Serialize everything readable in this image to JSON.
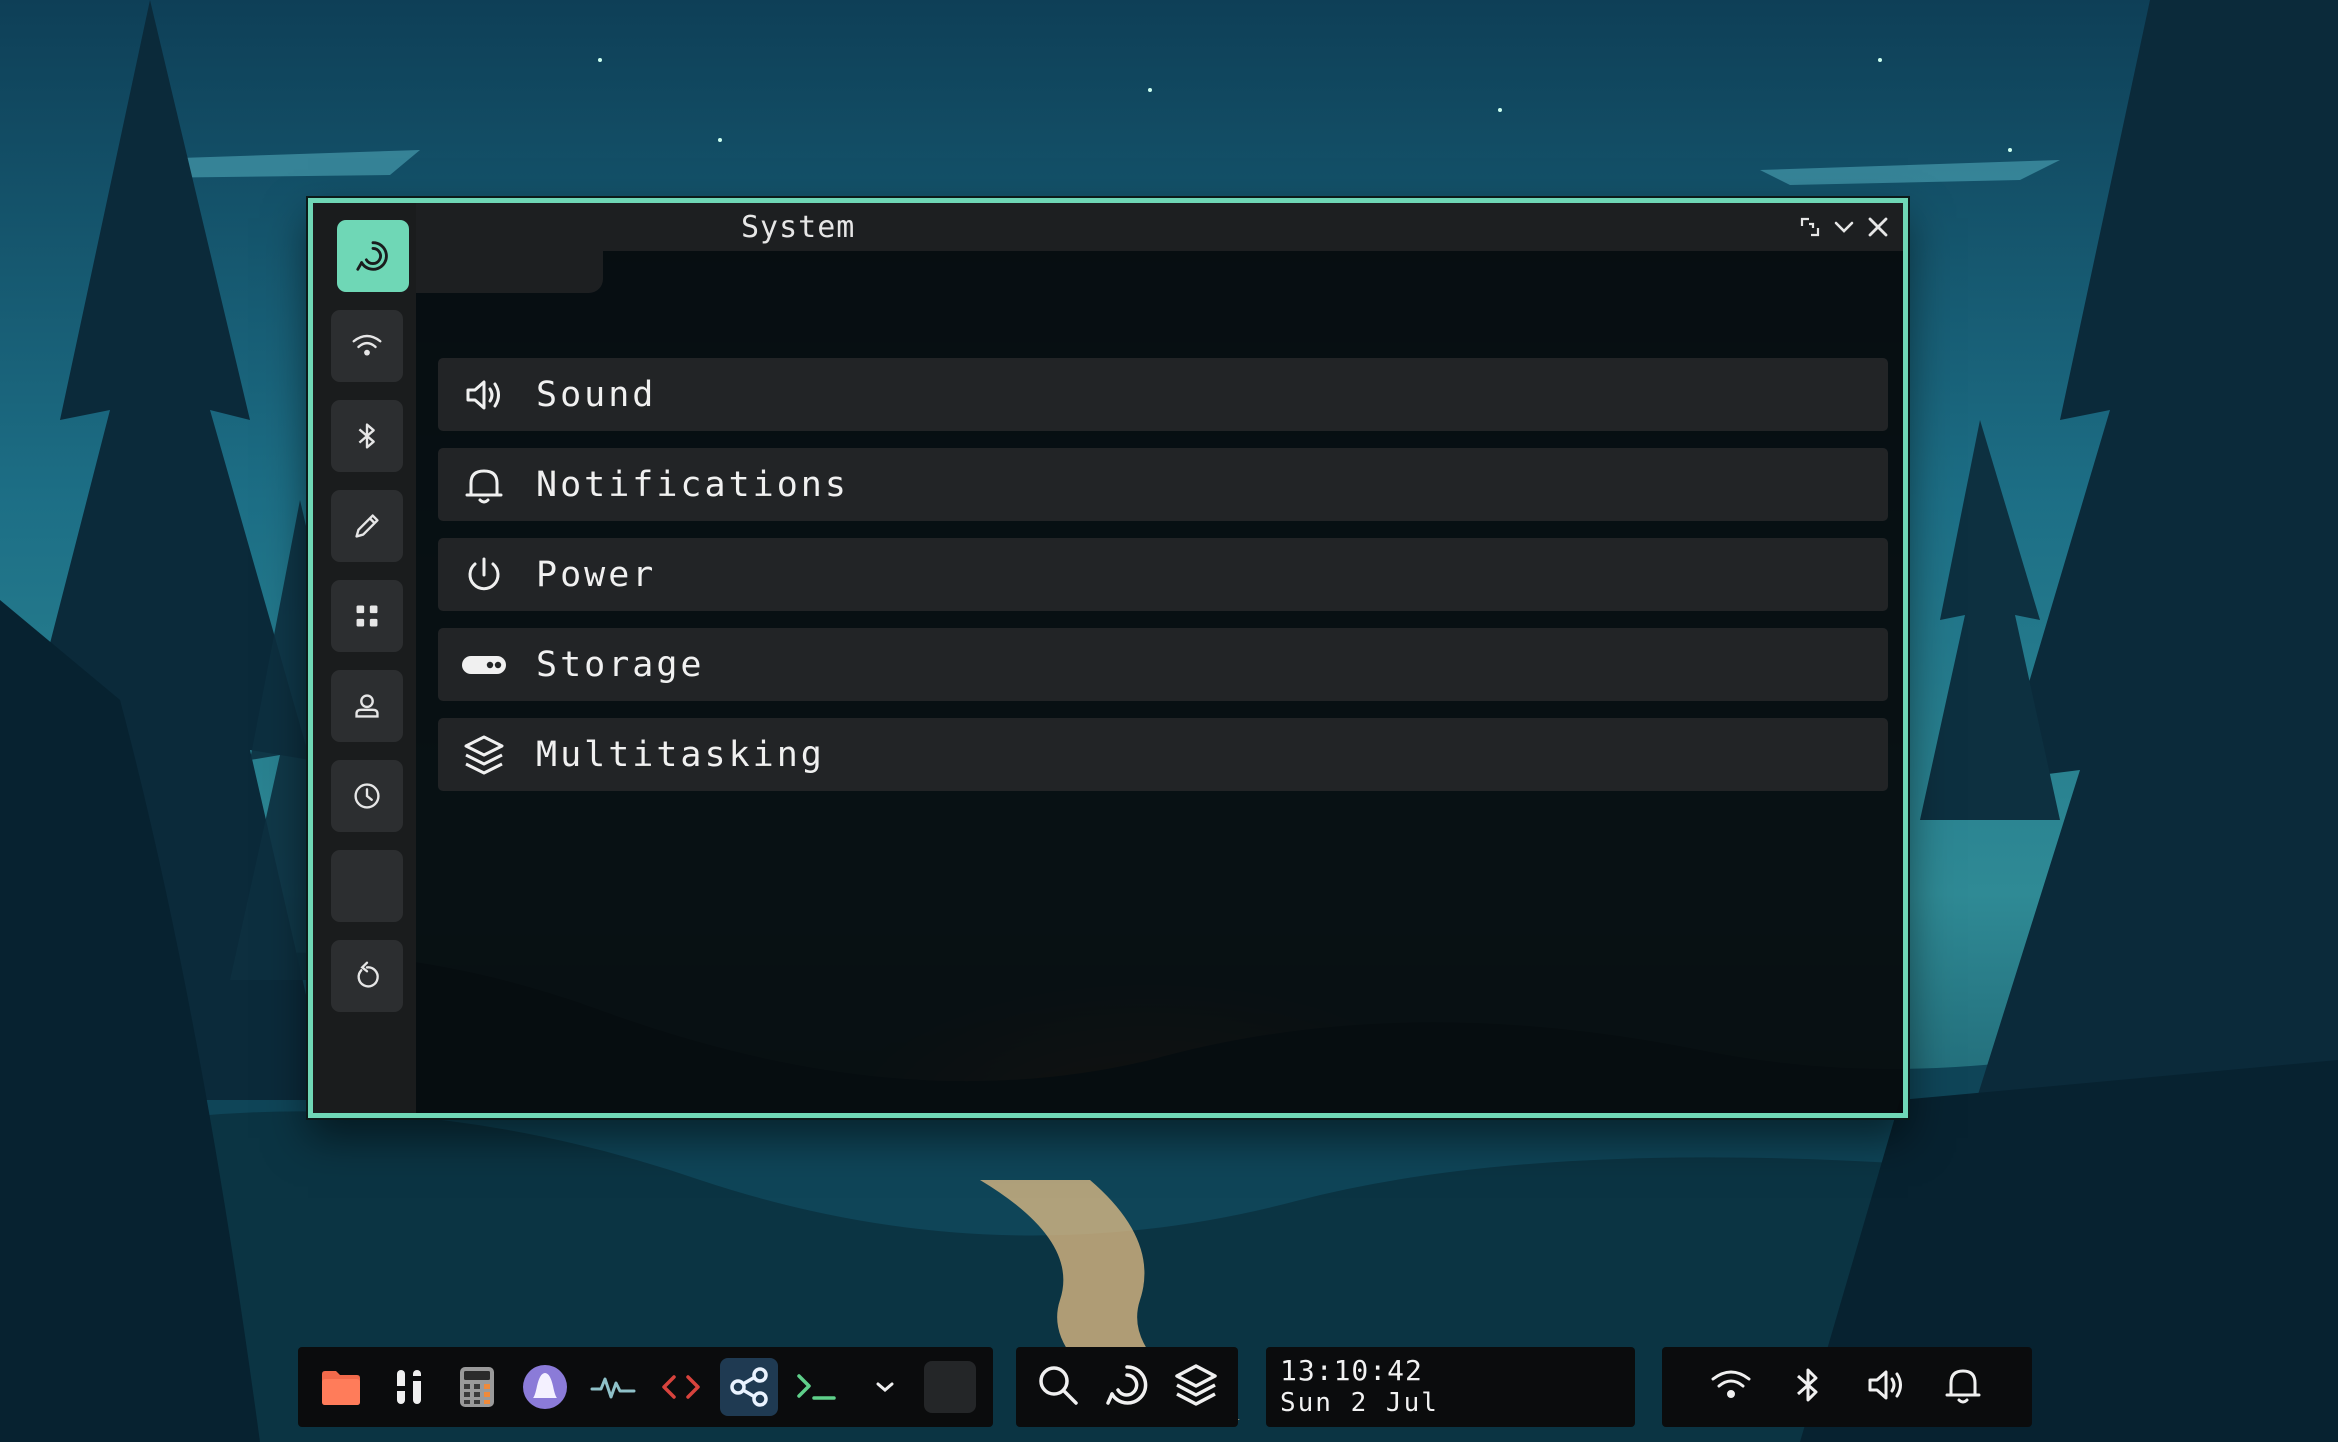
{
  "window": {
    "title": "System",
    "controls": [
      "restore-icon",
      "minimize-icon",
      "close-icon"
    ],
    "accent_color": "#6fd7b6"
  },
  "sidebar": {
    "items": [
      {
        "icon": "system-icon",
        "active": true
      },
      {
        "icon": "wifi-icon",
        "active": false
      },
      {
        "icon": "bluetooth-icon",
        "active": false
      },
      {
        "icon": "pencil-icon",
        "active": false
      },
      {
        "icon": "apps-grid-icon",
        "active": false
      },
      {
        "icon": "user-icon",
        "active": false
      },
      {
        "icon": "clock-icon",
        "active": false
      },
      {
        "icon": "blank",
        "active": false
      },
      {
        "icon": "reset-icon",
        "active": false
      }
    ]
  },
  "settings": {
    "items": [
      {
        "icon": "speaker-icon",
        "label": "Sound"
      },
      {
        "icon": "bell-icon",
        "label": "Notifications"
      },
      {
        "icon": "power-icon",
        "label": "Power"
      },
      {
        "icon": "storage-icon",
        "label": "Storage"
      },
      {
        "icon": "layers-icon",
        "label": "Multitasking"
      }
    ]
  },
  "taskbar": {
    "dock": [
      "files-icon",
      "mixer-icon",
      "calculator-icon",
      "launcher-icon",
      "activity-icon",
      "code-icon",
      "share-icon",
      "terminal-icon",
      "chevron-icon",
      "blank"
    ],
    "quick_actions": [
      "search-icon",
      "system-icon",
      "layers-icon"
    ],
    "clock": {
      "time": "13:10:42",
      "date": "Sun 2 Jul"
    },
    "tray": [
      "wifi-icon",
      "bluetooth-icon",
      "speaker-icon",
      "bell-icon"
    ]
  }
}
